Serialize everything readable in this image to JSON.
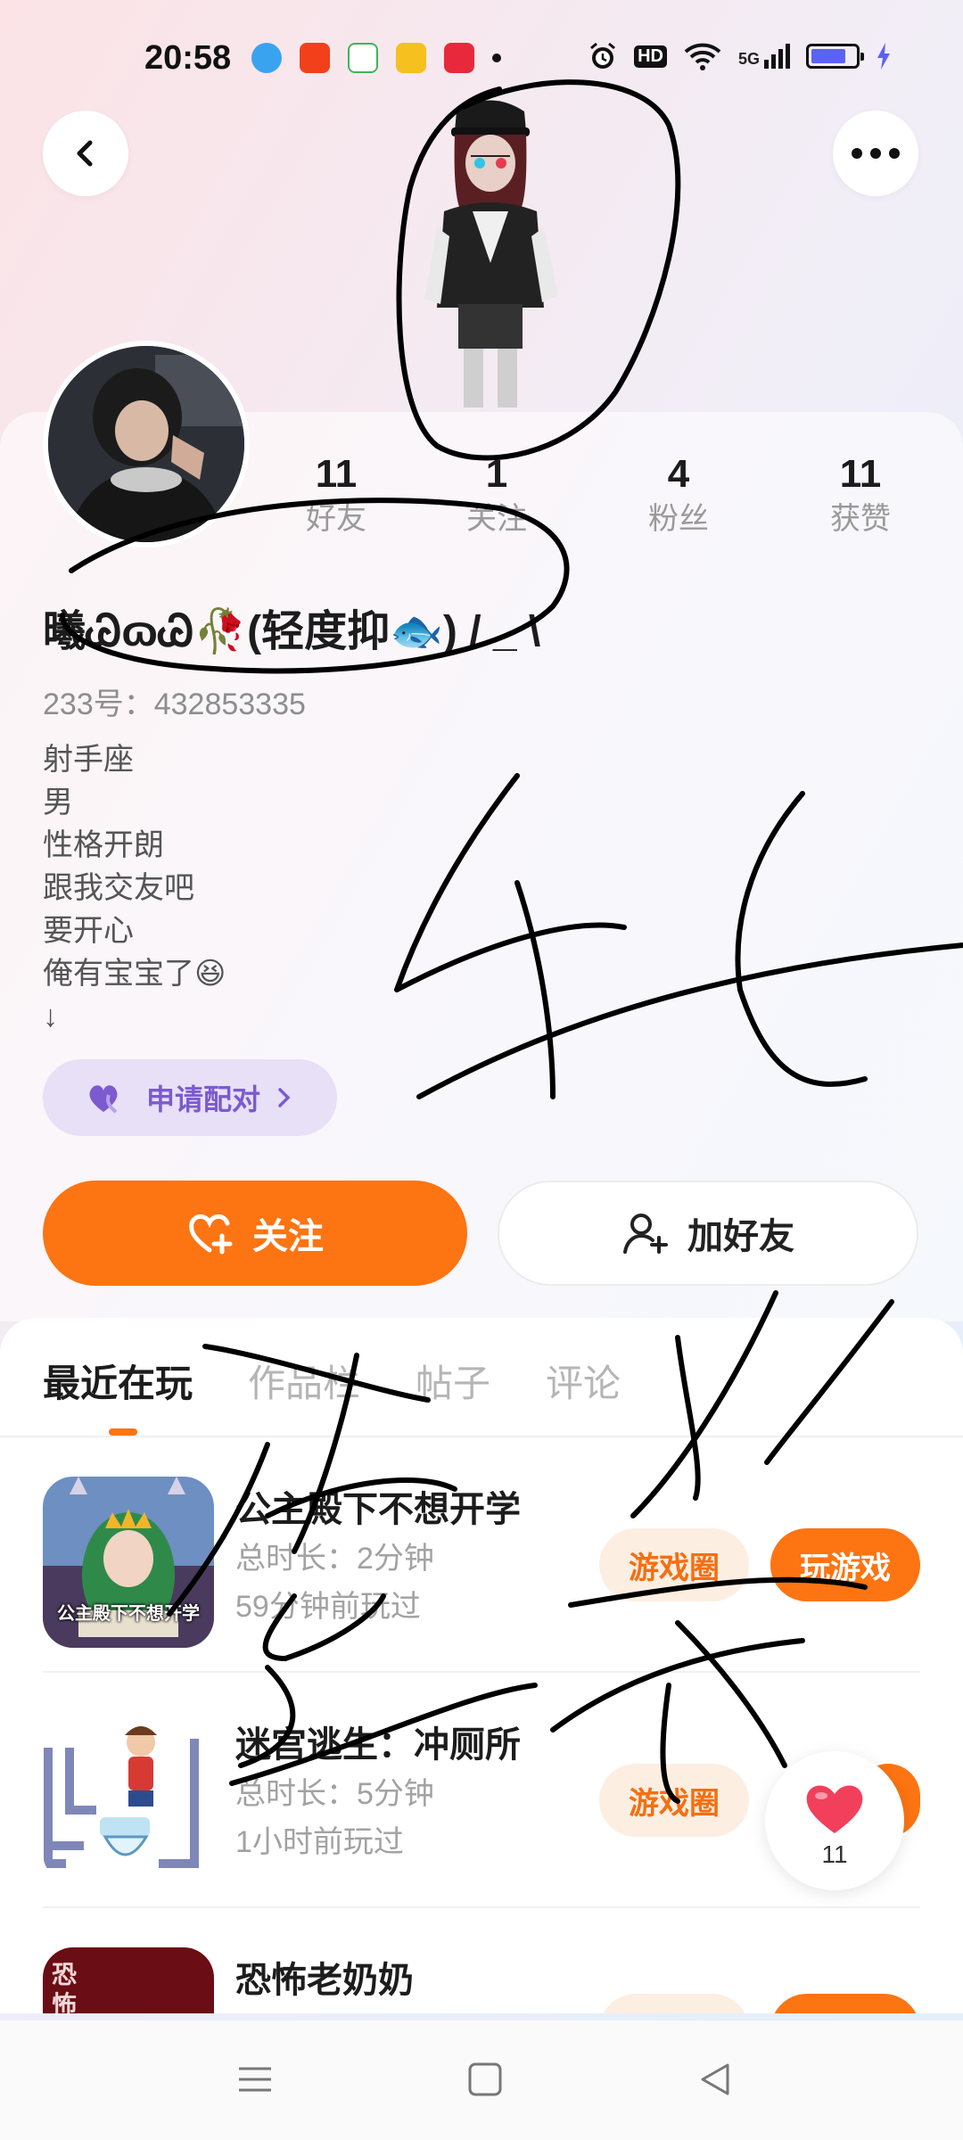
{
  "status_bar": {
    "time": "20:58",
    "right_labels": [
      "HD",
      "5G"
    ],
    "battery_color": "#5b63f5"
  },
  "top_bar": {
    "back_icon": "chevron-left-icon",
    "more_icon": "more-dots-icon"
  },
  "profile": {
    "stats": [
      {
        "value": "11",
        "label": "好友"
      },
      {
        "value": "1",
        "label": "关注"
      },
      {
        "value": "4",
        "label": "粉丝"
      },
      {
        "value": "11",
        "label": "获赞"
      }
    ],
    "nickname": "曦ᏊɷᏊ🥀(轻度抑🐟) / _ \\",
    "uid": "233号：432853335",
    "bio_lines": [
      "射手座",
      "男",
      "性格开朗",
      "跟我交友吧",
      "要开心",
      "俺有宝宝了😆",
      "↓"
    ],
    "match_button": "申请配对",
    "follow_button": "关注",
    "add_friend_button": "加好友"
  },
  "tabs": [
    "最近在玩",
    "作品栏",
    "帖子",
    "评论"
  ],
  "games": [
    {
      "title": "公主殿下不想开学",
      "duration": "总时长：2分钟",
      "last_played": "59分钟前玩过",
      "icon_text": "公主殿下不想开学",
      "circle_button": "游戏圈",
      "play_button": "玩游戏"
    },
    {
      "title": "迷宫逃生：冲厕所",
      "duration": "总时长：5分钟",
      "last_played": "1小时前玩过",
      "circle_button": "游戏圈"
    },
    {
      "title": "恐怖老奶奶",
      "icon_text": "恐怖"
    }
  ],
  "like_float": {
    "count": "11"
  },
  "colors": {
    "accent": "#fd7412",
    "match_purple": "#7c5ad0",
    "scribble": "#000000"
  }
}
